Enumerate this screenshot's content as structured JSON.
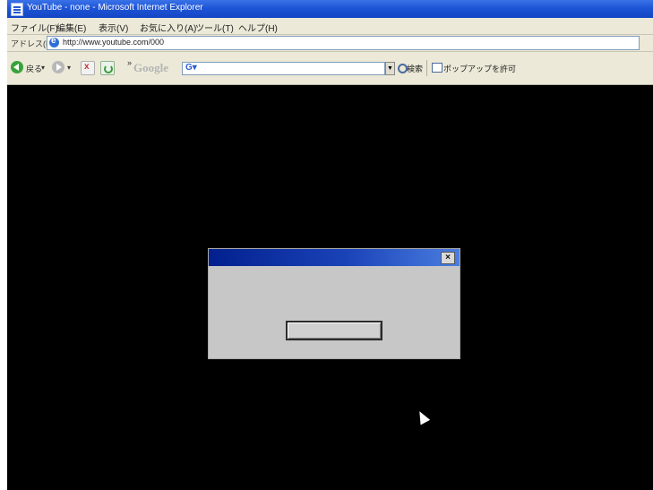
{
  "window": {
    "title": "YouTube - none - Microsoft Internet Explorer"
  },
  "menu": {
    "items": [
      "ファイル(F)",
      "編集(E)",
      "表示(V)",
      "お気に入り(A)",
      "ツール(T)",
      "ヘルプ(H)"
    ]
  },
  "address": {
    "label": "アドレス(D)",
    "url": "http://www.youtube.com/000"
  },
  "toolbar": {
    "back_label": "戻る",
    "chevron": "»",
    "google_logo": "Google",
    "google_box_text": "G▾",
    "search_label": "検索",
    "popup_label": "ポップアップを許可"
  },
  "dialog": {
    "close_label": "×",
    "button_label": ""
  },
  "colors": {
    "titlebar": "#1e55d6",
    "content_bg": "#000000",
    "dialog_title": "#02208e",
    "dialog_bg": "#c7c7c7"
  }
}
